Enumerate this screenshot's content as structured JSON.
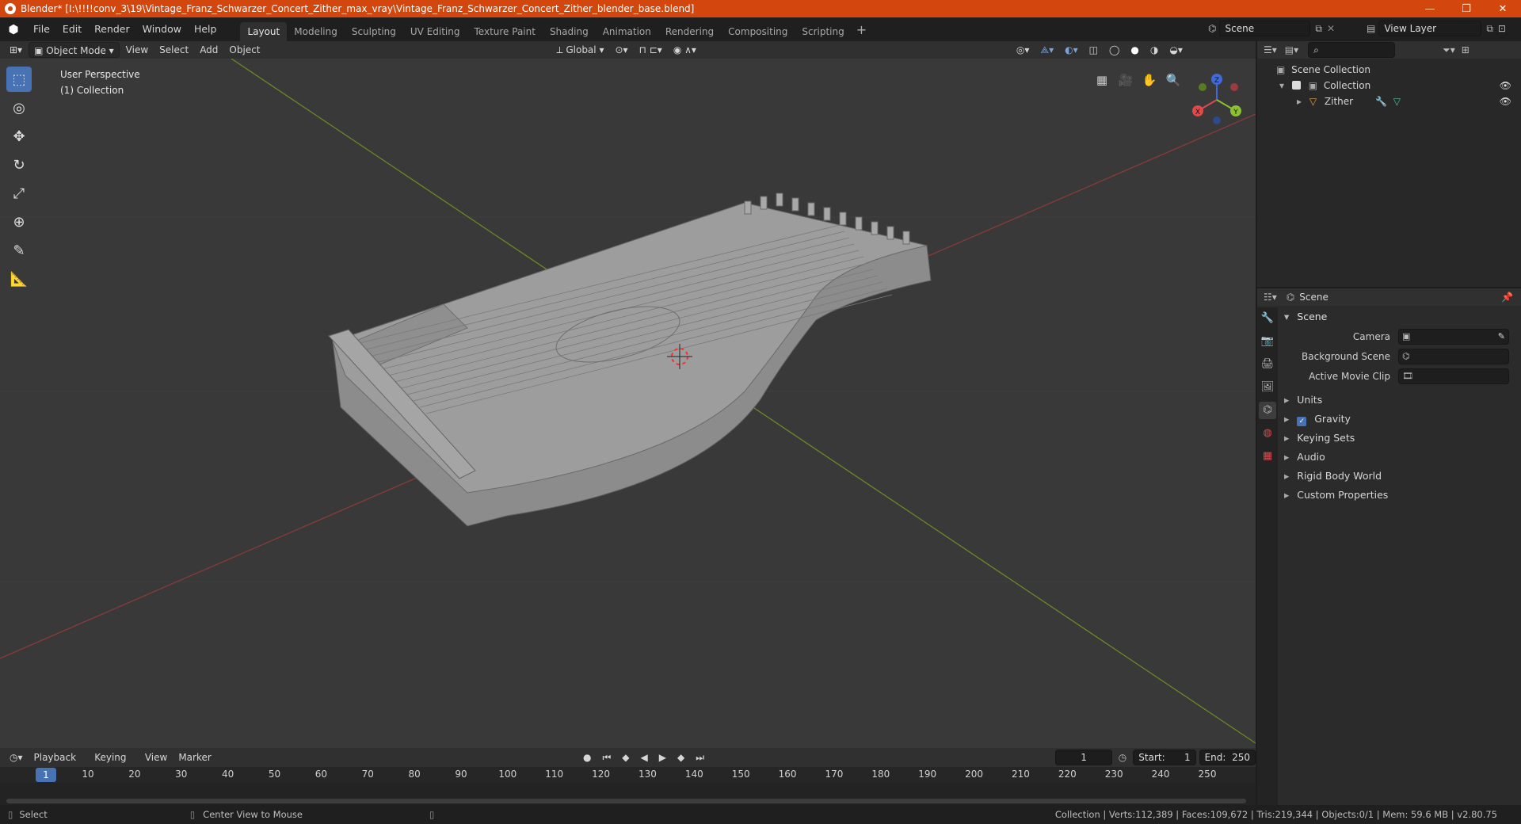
{
  "window": {
    "title": "Blender* [I:\\!!!!conv_3\\19\\Vintage_Franz_Schwarzer_Concert_Zither_max_vray\\Vintage_Franz_Schwarzer_Concert_Zither_blender_base.blend]",
    "minimize": "—",
    "maximize": "❐",
    "close": "✕"
  },
  "menubar": {
    "items": [
      "File",
      "Edit",
      "Render",
      "Window",
      "Help"
    ],
    "workspaces": [
      "Layout",
      "Modeling",
      "Sculpting",
      "UV Editing",
      "Texture Paint",
      "Shading",
      "Animation",
      "Rendering",
      "Compositing",
      "Scripting"
    ],
    "active_workspace": "Layout",
    "add_workspace": "+",
    "scene": "Scene",
    "view_layer": "View Layer"
  },
  "viewport_header": {
    "mode": "Object Mode",
    "menus": [
      "View",
      "Select",
      "Add",
      "Object"
    ],
    "orientation": "Global"
  },
  "viewport": {
    "perspective": "User Perspective",
    "collection": "(1) Collection",
    "axis_x": "X",
    "axis_y": "Y",
    "axis_z": "Z",
    "grid_color": "#404040",
    "x_axis_color": "#8a3a3a",
    "y_axis_color": "#6b8a22"
  },
  "outliner": {
    "root": "Scene Collection",
    "collection": "Collection",
    "object": "Zither"
  },
  "properties": {
    "header_title": "Scene",
    "panel_title": "Scene",
    "camera_label": "Camera",
    "background_scene_label": "Background Scene",
    "active_movie_clip_label": "Active Movie Clip",
    "subpanels": [
      "Units",
      "Gravity",
      "Keying Sets",
      "Audio",
      "Rigid Body World",
      "Custom Properties"
    ],
    "gravity_checked": true
  },
  "timeline": {
    "menus": [
      "Playback",
      "Keying",
      "View",
      "Marker"
    ],
    "current_frame": "1",
    "start_label": "Start:",
    "start": "1",
    "end_label": "End:",
    "end": "250",
    "ruler": [
      1,
      10,
      20,
      30,
      40,
      50,
      60,
      70,
      80,
      90,
      100,
      110,
      120,
      130,
      140,
      150,
      160,
      170,
      180,
      190,
      200,
      210,
      220,
      230,
      240,
      250
    ]
  },
  "statusbar": {
    "left_action": "Select",
    "middle_action": "Center View to Mouse",
    "stats": "Collection | Verts:112,389 | Faces:109,672 | Tris:219,344 | Objects:0/1 | Mem: 59.6 MB | v2.80.75"
  },
  "accent": "#4772b3",
  "title_bar_color": "#d3470f"
}
